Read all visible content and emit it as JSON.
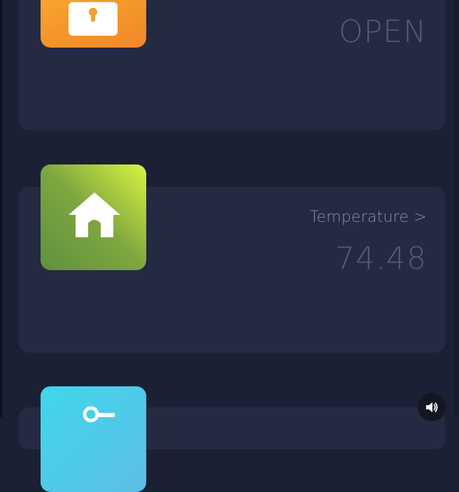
{
  "cards": [
    {
      "id": "lock",
      "status_value": "OPEN"
    },
    {
      "id": "home",
      "label": "Temperature >",
      "value": "74.48"
    }
  ],
  "controls": {
    "sound": "speaker-icon"
  },
  "colors": {
    "background": "#1b2035",
    "card": "#242a42",
    "lock_tile": "#f59a2b",
    "home_tile_start": "#5f913f",
    "home_tile_end": "#d8f542",
    "key_tile": "#3fd7ec"
  },
  "icons": [
    "lock-icon",
    "home-icon",
    "key-icon",
    "speaker-icon"
  ]
}
